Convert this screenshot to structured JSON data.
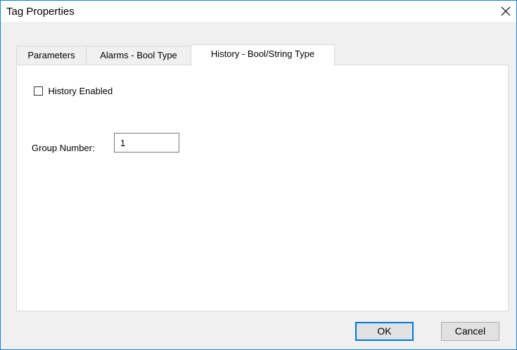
{
  "window": {
    "title": "Tag Properties",
    "close_icon": "close-icon"
  },
  "tabs": [
    {
      "label": "Parameters"
    },
    {
      "label": "Alarms - Bool Type"
    },
    {
      "label": "History - Bool/String Type",
      "selected": true
    }
  ],
  "history": {
    "history_enabled_label": "History Enabled",
    "history_enabled_checked": false,
    "group_number_label": "Group Number:",
    "group_number_value": "1"
  },
  "buttons": {
    "ok_label": "OK",
    "cancel_label": "Cancel"
  },
  "colors": {
    "accent": "#0078d7",
    "window_border": "#1883d7",
    "dialog_background": "#f0f0f0"
  }
}
